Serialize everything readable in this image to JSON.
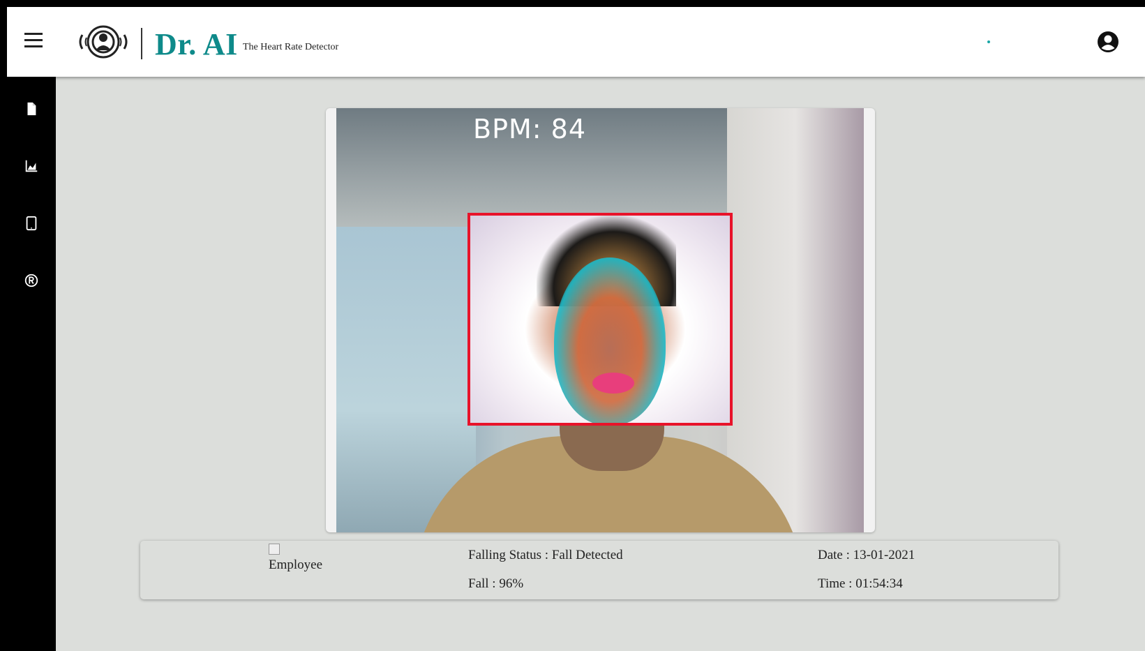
{
  "header": {
    "brand_name": "Dr. AI",
    "brand_tagline": "The Heart Rate Detector",
    "menu_icon": "hamburger-menu-icon",
    "logo_icon": "wireless-person-icon",
    "account_icon": "account-circle-icon",
    "accent_color": "#0e8a8a"
  },
  "sidebar": {
    "items": [
      {
        "name": "file-icon"
      },
      {
        "name": "area-chart-icon"
      },
      {
        "name": "tablet-icon"
      },
      {
        "name": "registered-icon"
      }
    ]
  },
  "video": {
    "bpm_text": "BPM: 84",
    "face_box_color": "#e8132a"
  },
  "info": {
    "employee_alt": "Employee",
    "falling_status": "Falling Status : Fall Detected",
    "fall_percent": "Fall : 96%",
    "date": "Date : 13-01-2021",
    "time": "Time : 01:54:34"
  }
}
